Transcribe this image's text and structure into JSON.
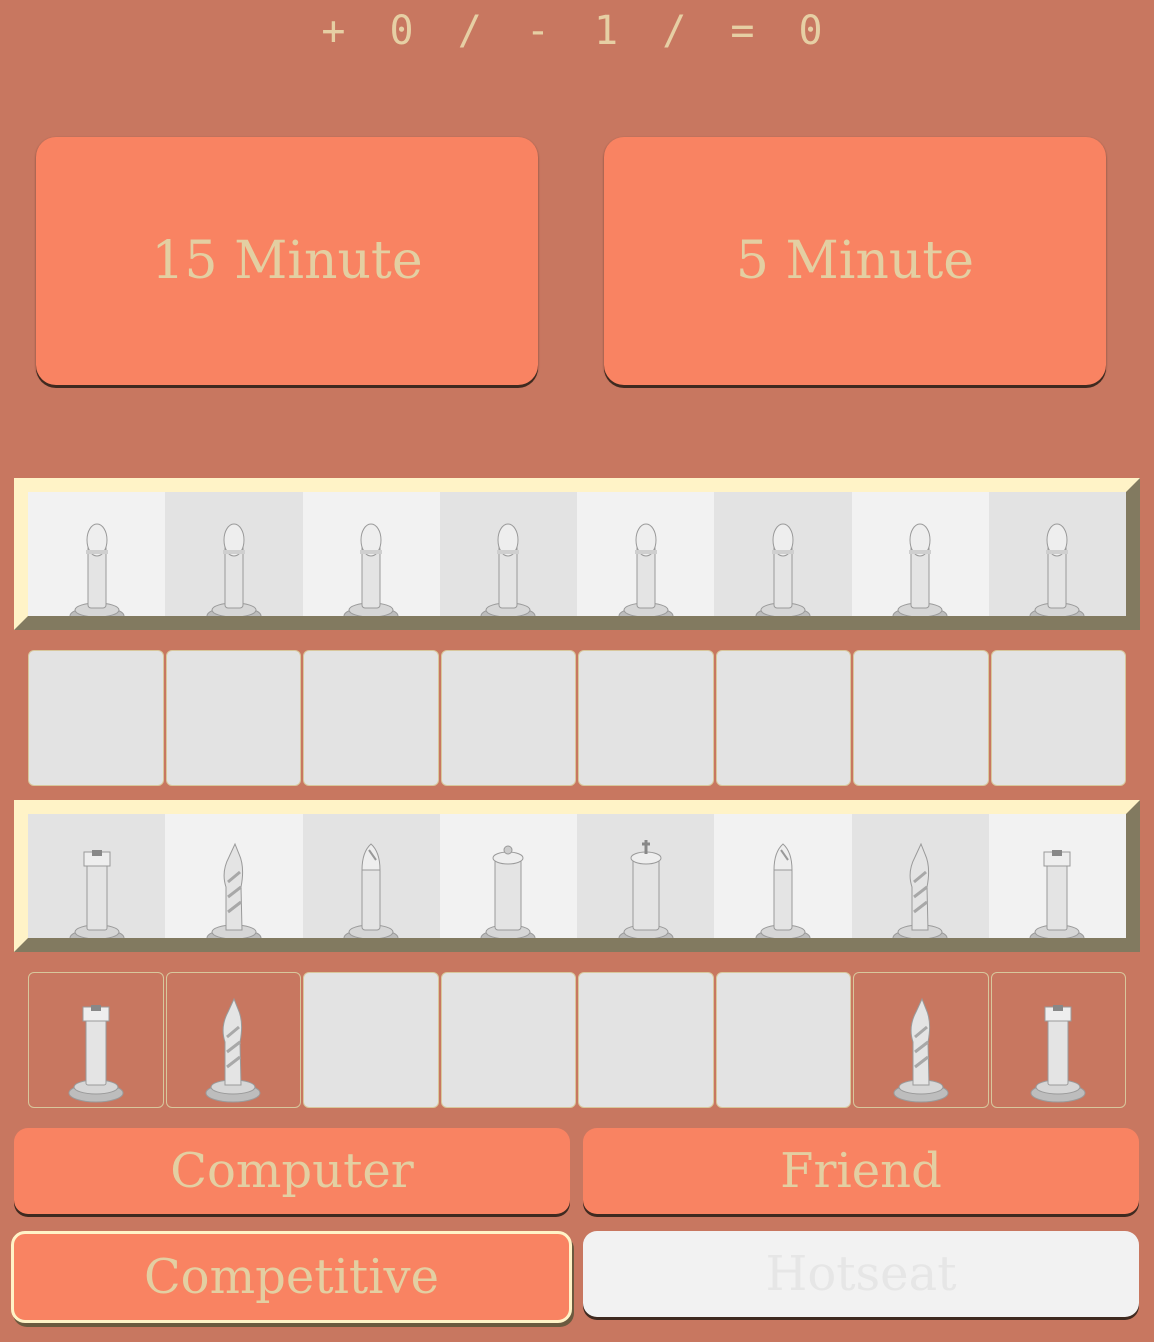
{
  "score": "+ 0 / - 1 / = 0",
  "time_options": [
    "15 Minute",
    "5 Minute"
  ],
  "pawn_row": [
    "pawn",
    "pawn",
    "pawn",
    "pawn",
    "pawn",
    "pawn",
    "pawn",
    "pawn"
  ],
  "back_row": [
    "rook",
    "knight",
    "bishop",
    "queen",
    "king",
    "bishop",
    "knight",
    "rook"
  ],
  "captured_slots_top": [
    "",
    "",
    "",
    "",
    "",
    "",
    "",
    ""
  ],
  "captured_slots_bottom": [
    "rook",
    "knight",
    "",
    "",
    "",
    "",
    "knight",
    "rook"
  ],
  "opponent": {
    "computer": "Computer",
    "friend": "Friend"
  },
  "mode": {
    "competitive": "Competitive",
    "hotseat": "Hotseat"
  }
}
